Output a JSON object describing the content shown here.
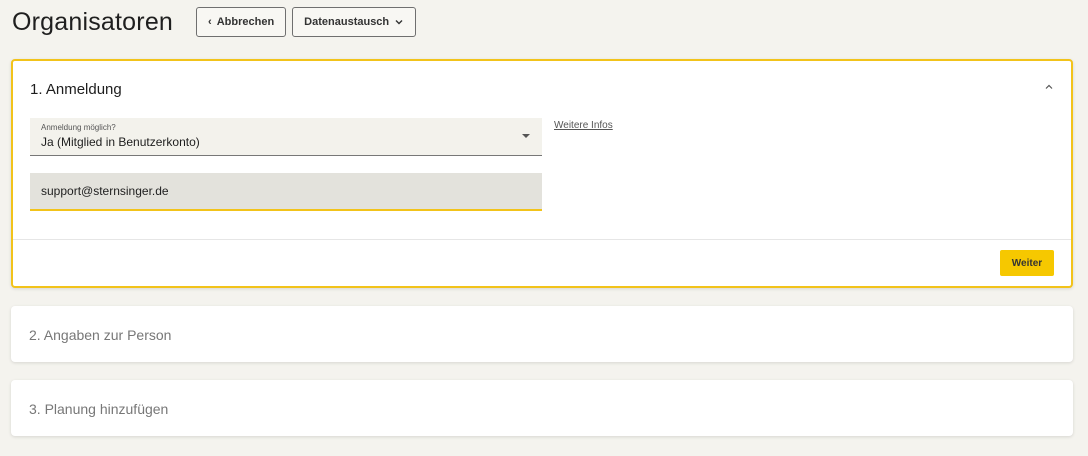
{
  "header": {
    "title": "Organisatoren",
    "cancel_label": "Abbrechen",
    "exchange_label": "Datenaustausch"
  },
  "step1": {
    "title": "1. Anmeldung",
    "select": {
      "label": "Anmeldung möglich?",
      "value": "Ja (Mitglied in Benutzerkonto)"
    },
    "info_link": "Weitere Infos",
    "email": {
      "value": "support@sternsinger.de"
    },
    "next_label": "Weiter"
  },
  "step2": {
    "title": "2. Angaben zur Person"
  },
  "step3": {
    "title": "3. Planung hinzufügen"
  },
  "colors": {
    "accent": "#f2c31a",
    "button": "#f6c800",
    "background": "#f4f3ee"
  }
}
